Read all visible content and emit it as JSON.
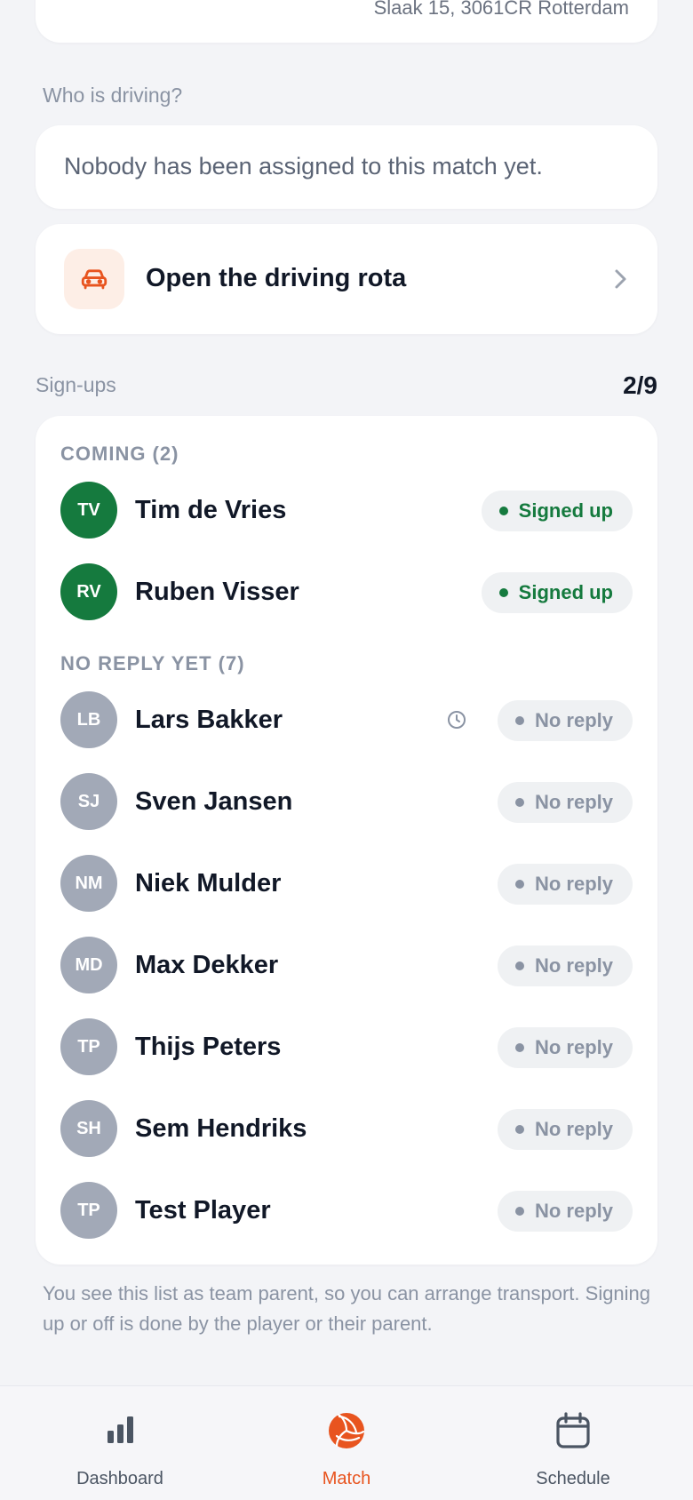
{
  "match": {
    "address": "Slaak 15, 3061CR Rotterdam"
  },
  "driving": {
    "section_label": "Who is driving?",
    "empty_text": "Nobody has been assigned to this match yet.",
    "rota_label": "Open the driving rota",
    "rota_icon": "car-icon"
  },
  "signups": {
    "section_label": "Sign-ups",
    "count": "2/9",
    "coming_title": "COMING (2)",
    "noreply_title": "NO REPLY YET (7)",
    "coming": [
      {
        "initials": "TV",
        "name": "Tim de Vries",
        "status": "Signed up"
      },
      {
        "initials": "RV",
        "name": "Ruben Visser",
        "status": "Signed up"
      }
    ],
    "no_reply": [
      {
        "initials": "LB",
        "name": "Lars Bakker",
        "status": "No reply",
        "icon": "clock-icon"
      },
      {
        "initials": "SJ",
        "name": "Sven Jansen",
        "status": "No reply"
      },
      {
        "initials": "NM",
        "name": "Niek Mulder",
        "status": "No reply"
      },
      {
        "initials": "MD",
        "name": "Max Dekker",
        "status": "No reply"
      },
      {
        "initials": "TP",
        "name": "Thijs Peters",
        "status": "No reply"
      },
      {
        "initials": "SH",
        "name": "Sem Hendriks",
        "status": "No reply"
      },
      {
        "initials": "TP",
        "name": "Test Player",
        "status": "No reply"
      }
    ]
  },
  "footer_note": "You see this list as team parent, so you can arrange transport. Signing up or off is done by the player or their parent.",
  "tabs": [
    {
      "label": "Dashboard",
      "icon": "bar-chart-icon",
      "active": false
    },
    {
      "label": "Match",
      "icon": "volleyball-icon",
      "active": true
    },
    {
      "label": "Schedule",
      "icon": "calendar-icon",
      "active": false
    }
  ],
  "colors": {
    "accent": "#e8541f",
    "signed_up": "#157a3e",
    "no_reply": "#8a93a3",
    "background": "#f3f4f7"
  }
}
